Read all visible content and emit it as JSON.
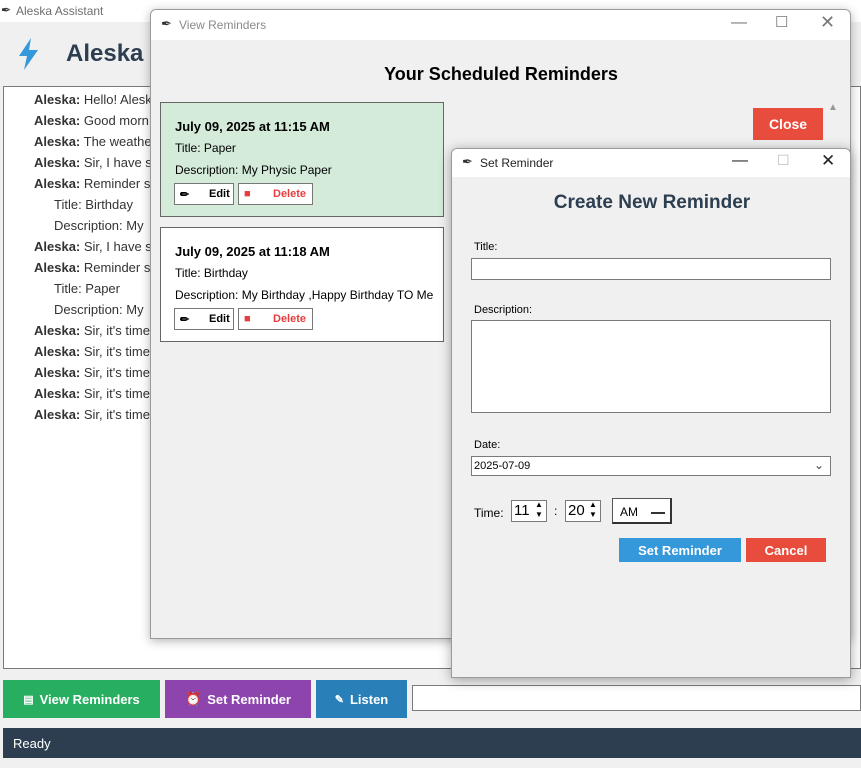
{
  "main": {
    "title": "Aleska Assistant",
    "header_title": "Aleska",
    "chat": [
      {
        "speaker": "Aleska:",
        "text": "Hello! Alesk"
      },
      {
        "speaker": "Aleska:",
        "text": "Good morn"
      },
      {
        "speaker": "Aleska:",
        "text": "The weathe"
      },
      {
        "speaker": "Aleska:",
        "text": "Sir, I have su"
      },
      {
        "speaker": "Aleska:",
        "text": "Reminder se"
      },
      {
        "speaker": "",
        "text": "Title: Birthday"
      },
      {
        "speaker": "",
        "text": "Description: My"
      },
      {
        "speaker": "Aleska:",
        "text": "Sir, I have su"
      },
      {
        "speaker": "Aleska:",
        "text": "Reminder se"
      },
      {
        "speaker": "",
        "text": "Title: Paper"
      },
      {
        "speaker": "",
        "text": "Description: My"
      },
      {
        "speaker": "Aleska:",
        "text": "Sir, it's time"
      },
      {
        "speaker": "Aleska:",
        "text": "Sir, it's time"
      },
      {
        "speaker": "Aleska:",
        "text": "Sir, it's time"
      },
      {
        "speaker": "Aleska:",
        "text": "Sir, it's time"
      },
      {
        "speaker": "Aleska:",
        "text": "Sir, it's time"
      }
    ],
    "buttons": {
      "view_reminders": "View Reminders",
      "set_reminder": "Set Reminder",
      "listen": "Listen"
    },
    "status": "Ready"
  },
  "view_reminders": {
    "window_title": "View Reminders",
    "heading": "Your Scheduled Reminders",
    "close_label": "Close",
    "cards": [
      {
        "date": "July 09, 2025 at 11:15 AM",
        "title_label": "Title:",
        "title": "Paper",
        "desc_label": "Description:",
        "description": "My Physic Paper",
        "edit": "Edit",
        "delete": "Delete"
      },
      {
        "date": "July 09, 2025 at 11:18 AM",
        "title_label": "Title:",
        "title": "Birthday",
        "desc_label": "Description:",
        "description": "My Birthday ,Happy Birthday TO Me",
        "edit": "Edit",
        "delete": "Delete"
      }
    ]
  },
  "set_reminder": {
    "window_title": "Set Reminder",
    "heading": "Create New Reminder",
    "title_label": "Title:",
    "title_value": "",
    "description_label": "Description:",
    "description_value": "",
    "date_label": "Date:",
    "date_value": "2025-07-09",
    "time_label": "Time:",
    "hour": "11",
    "separator": ":",
    "minute": "20",
    "ampm": "AM",
    "set_button": "Set Reminder",
    "cancel_button": "Cancel"
  },
  "colors": {
    "green": "#27ae60",
    "purple": "#8e44ad",
    "blue": "#2980b9",
    "red": "#e74c3c",
    "navy": "#2c3e50",
    "card_active": "#d4ebd9"
  }
}
